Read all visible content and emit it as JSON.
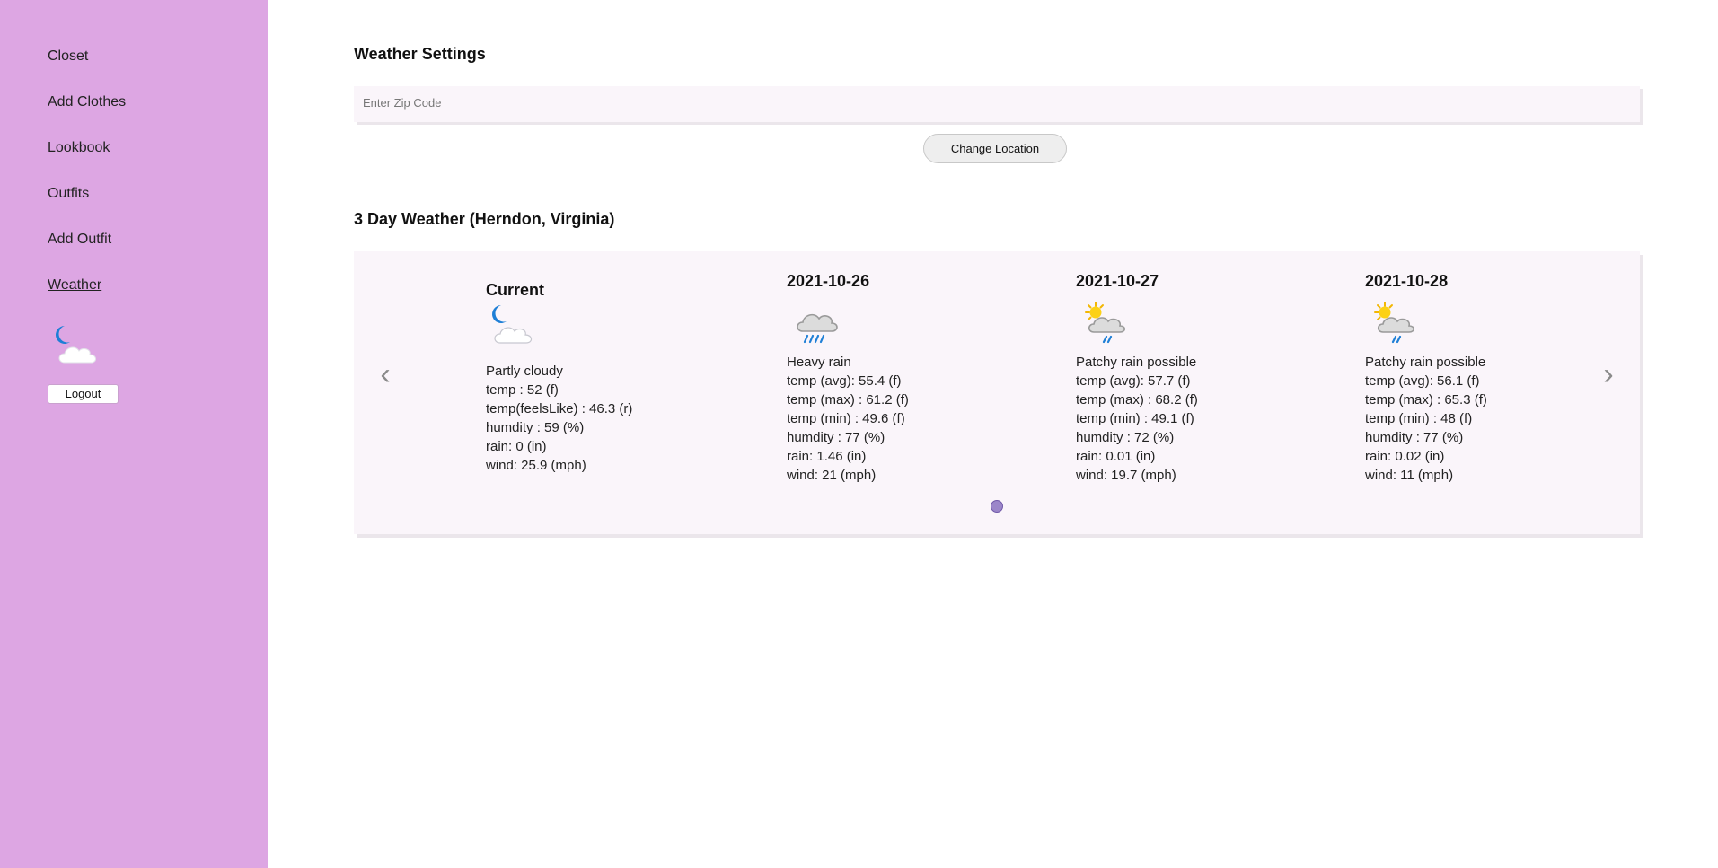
{
  "sidebar": {
    "items": [
      {
        "label": "Closet"
      },
      {
        "label": "Add Clothes"
      },
      {
        "label": "Lookbook"
      },
      {
        "label": "Outfits"
      },
      {
        "label": "Add Outfit"
      },
      {
        "label": "Weather",
        "active": true
      }
    ],
    "weather_icon": "night-partly-cloudy-icon",
    "logout_label": "Logout",
    "background_color": "#dda6e3"
  },
  "settings": {
    "title": "Weather Settings",
    "zip_placeholder": "Enter Zip Code",
    "zip_value": "",
    "change_location_label": "Change Location"
  },
  "forecast": {
    "title": "3 Day Weather (Herndon, Virginia)",
    "current": {
      "title": "Current",
      "icon": "night-partly-cloudy-icon",
      "condition": "Partly cloudy",
      "temp": "temp : 52 (f)",
      "feels_like": "temp(feelsLike) : 46.3 (r)",
      "humidity": "humdity : 59 (%)",
      "rain": "rain: 0 (in)",
      "wind": "wind: 25.9 (mph)"
    },
    "days": [
      {
        "date": "2021-10-26",
        "icon": "heavy-rain-icon",
        "condition": "Heavy rain",
        "temp_avg": "temp (avg): 55.4 (f)",
        "temp_max": "temp (max) : 61.2 (f)",
        "temp_min": "temp (min) : 49.6 (f)",
        "humidity": "humdity : 77 (%)",
        "rain": "rain: 1.46 (in)",
        "wind": "wind: 21 (mph)"
      },
      {
        "date": "2021-10-27",
        "icon": "patchy-rain-sun-icon",
        "condition": "Patchy rain possible",
        "temp_avg": "temp (avg): 57.7 (f)",
        "temp_max": "temp (max) : 68.2 (f)",
        "temp_min": "temp (min) : 49.1 (f)",
        "humidity": "humdity : 72 (%)",
        "rain": "rain: 0.01 (in)",
        "wind": "wind: 19.7 (mph)"
      },
      {
        "date": "2021-10-28",
        "icon": "patchy-rain-sun-icon",
        "condition": "Patchy rain possible",
        "temp_avg": "temp (avg): 56.1 (f)",
        "temp_max": "temp (max) : 65.3 (f)",
        "temp_min": "temp (min) : 48 (f)",
        "humidity": "humdity : 77 (%)",
        "rain": "rain: 0.02 (in)",
        "wind": "wind: 11 (mph)"
      }
    ],
    "prev_arrow": "‹",
    "next_arrow": "›"
  }
}
